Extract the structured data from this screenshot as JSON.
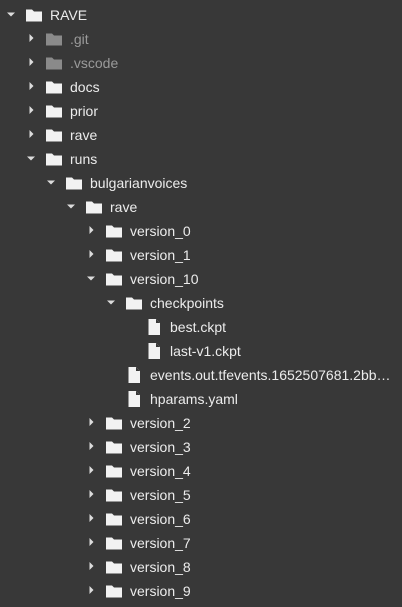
{
  "tree": {
    "colors": {
      "background": "#383838",
      "text": "#ececec",
      "muted_text": "#9a9a9a",
      "folder": "#f2f2f2",
      "folder_muted": "#8a8a8a",
      "chevron": "#dcdcdc"
    },
    "rows": [
      {
        "label": "RAVE",
        "depth": 0,
        "kind": "folder",
        "expanded": true,
        "muted": false
      },
      {
        "label": ".git",
        "depth": 1,
        "kind": "folder",
        "expanded": false,
        "muted": true
      },
      {
        "label": ".vscode",
        "depth": 1,
        "kind": "folder",
        "expanded": false,
        "muted": true
      },
      {
        "label": "docs",
        "depth": 1,
        "kind": "folder",
        "expanded": false,
        "muted": false
      },
      {
        "label": "prior",
        "depth": 1,
        "kind": "folder",
        "expanded": false,
        "muted": false
      },
      {
        "label": "rave",
        "depth": 1,
        "kind": "folder",
        "expanded": false,
        "muted": false
      },
      {
        "label": "runs",
        "depth": 1,
        "kind": "folder",
        "expanded": true,
        "muted": false
      },
      {
        "label": "bulgarianvoices",
        "depth": 2,
        "kind": "folder",
        "expanded": true,
        "muted": false
      },
      {
        "label": "rave",
        "depth": 3,
        "kind": "folder",
        "expanded": true,
        "muted": false
      },
      {
        "label": "version_0",
        "depth": 4,
        "kind": "folder",
        "expanded": false,
        "muted": false
      },
      {
        "label": "version_1",
        "depth": 4,
        "kind": "folder",
        "expanded": false,
        "muted": false
      },
      {
        "label": "version_10",
        "depth": 4,
        "kind": "folder",
        "expanded": true,
        "muted": false
      },
      {
        "label": "checkpoints",
        "depth": 5,
        "kind": "folder",
        "expanded": true,
        "muted": false
      },
      {
        "label": "best.ckpt",
        "depth": 6,
        "kind": "file",
        "muted": false
      },
      {
        "label": "last-v1.ckpt",
        "depth": 6,
        "kind": "file",
        "muted": false
      },
      {
        "label": "events.out.tfevents.1652507681.2bb…",
        "depth": 5,
        "kind": "file",
        "muted": false
      },
      {
        "label": "hparams.yaml",
        "depth": 5,
        "kind": "file",
        "muted": false
      },
      {
        "label": "version_2",
        "depth": 4,
        "kind": "folder",
        "expanded": false,
        "muted": false
      },
      {
        "label": "version_3",
        "depth": 4,
        "kind": "folder",
        "expanded": false,
        "muted": false
      },
      {
        "label": "version_4",
        "depth": 4,
        "kind": "folder",
        "expanded": false,
        "muted": false
      },
      {
        "label": "version_5",
        "depth": 4,
        "kind": "folder",
        "expanded": false,
        "muted": false
      },
      {
        "label": "version_6",
        "depth": 4,
        "kind": "folder",
        "expanded": false,
        "muted": false
      },
      {
        "label": "version_7",
        "depth": 4,
        "kind": "folder",
        "expanded": false,
        "muted": false
      },
      {
        "label": "version_8",
        "depth": 4,
        "kind": "folder",
        "expanded": false,
        "muted": false
      },
      {
        "label": "version_9",
        "depth": 4,
        "kind": "folder",
        "expanded": false,
        "muted": false
      }
    ]
  }
}
